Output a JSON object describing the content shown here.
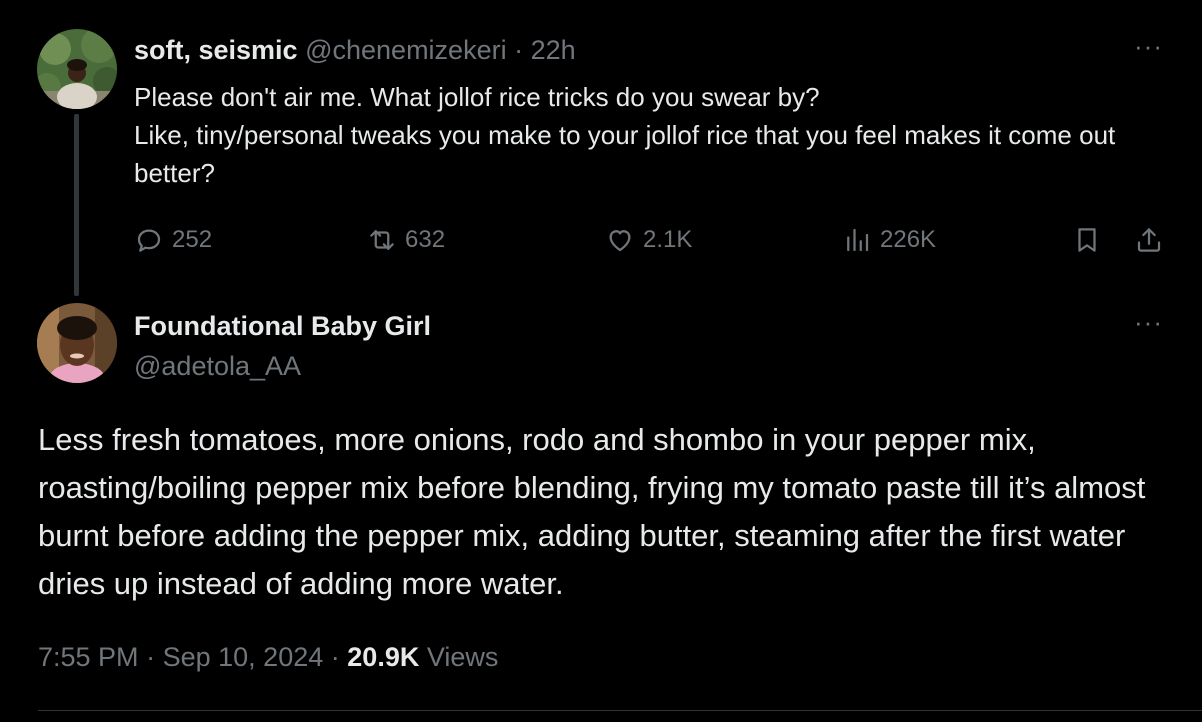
{
  "colors": {
    "background": "#000000",
    "text_primary": "#e7e9ea",
    "text_secondary": "#71767b",
    "divider": "#2f3336"
  },
  "tweet1": {
    "display_name": "soft, seismic",
    "handle": "@chenemizekeri",
    "separator": "·",
    "time_ago": "22h",
    "more_label": "···",
    "text_line1": "Please don't air me. What jollof rice tricks do you swear by?",
    "text_line2": "Like, tiny/personal tweaks you make to your jollof rice that you feel makes it come out better?",
    "stats": {
      "replies": "252",
      "reposts": "632",
      "likes": "2.1K",
      "views": "226K"
    },
    "icons": [
      "reply-icon",
      "repost-icon",
      "like-icon",
      "views-icon",
      "bookmark-icon",
      "share-icon"
    ]
  },
  "tweet2": {
    "display_name": "Foundational Baby Girl",
    "handle": "@adetola_AA",
    "more_label": "···",
    "text": "Less fresh tomatoes, more onions, rodo and shombo in your pepper mix, roasting/boiling pepper mix before blending, frying my tomato paste till it’s almost burnt before adding the pepper mix, adding butter, steaming after the first water dries up instead of adding more water.",
    "time": "7:55 PM",
    "sep1": "·",
    "date": "Sep 10, 2024",
    "sep2": "·",
    "views_count": "20.9K",
    "views_label": "Views"
  }
}
